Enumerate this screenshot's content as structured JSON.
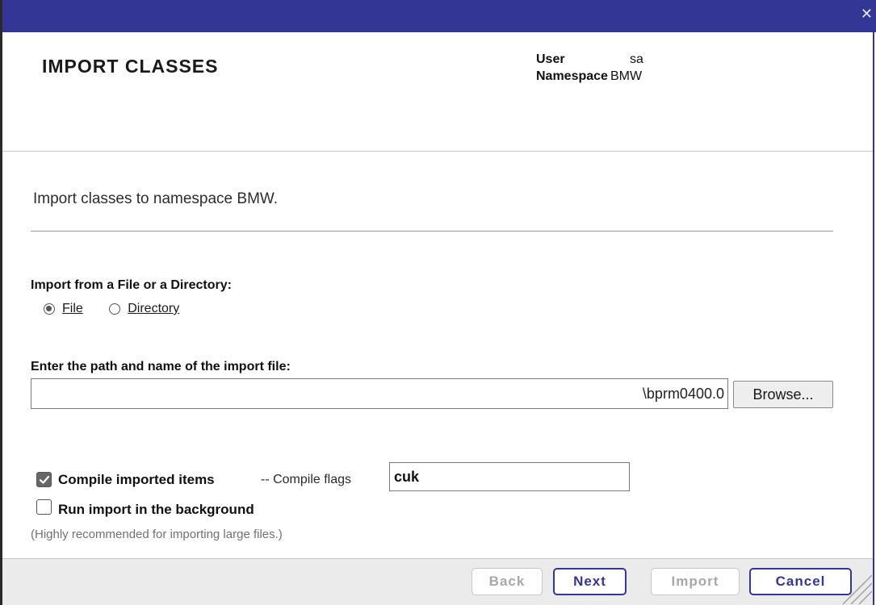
{
  "window": {
    "close_icon": "close-icon",
    "accent_color": "#333695"
  },
  "header": {
    "title": "IMPORT CLASSES",
    "user_label": "User",
    "user_value": "sa",
    "namespace_label": "Namespace",
    "namespace_value": "BMW"
  },
  "intro_text": "Import classes to namespace BMW.",
  "source": {
    "label": "Import from a File or a Directory:",
    "options": [
      {
        "label": "File",
        "selected": true
      },
      {
        "label": "Directory",
        "selected": false
      }
    ]
  },
  "path": {
    "label": "Enter the path and name of the import file:",
    "value": "\\bprm0400.0",
    "browse_label": "Browse..."
  },
  "compile": {
    "checked": true,
    "label": "Compile imported items",
    "flags_label": "-- Compile flags",
    "flags_value": "cuk"
  },
  "background": {
    "checked": false,
    "label": "Run import in the background",
    "hint": "(Highly recommended for importing large files.)"
  },
  "footer": {
    "back_label": "Back",
    "next_label": "Next",
    "import_label": "Import",
    "cancel_label": "Cancel"
  }
}
